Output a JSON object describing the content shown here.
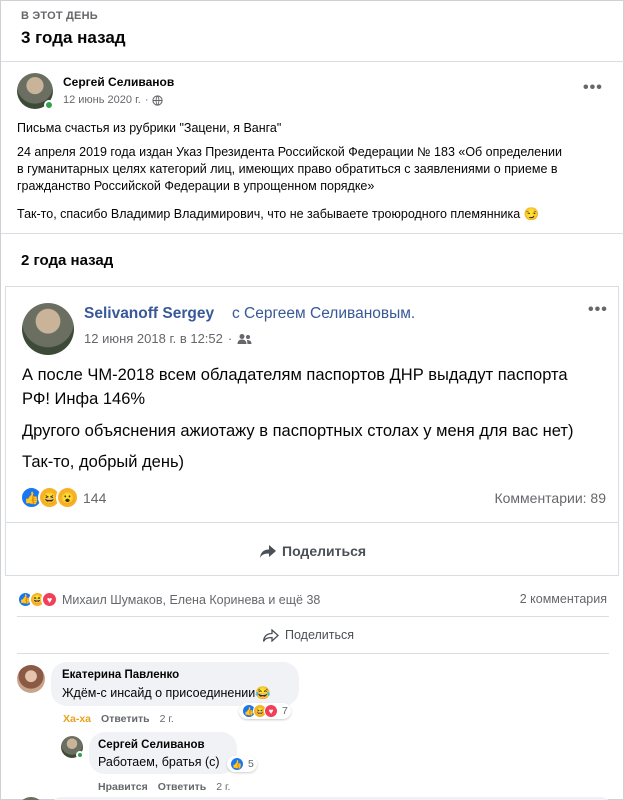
{
  "memory": {
    "label": "В ЭТОТ ДЕНЬ",
    "title": "3 года назад"
  },
  "post1": {
    "author": "Сергей Селиванов",
    "date": "12 июнь 2020 г.",
    "menu": "•••",
    "lines": [
      "Письма счастья из рубрики \"Зацени, я Ванга\"",
      "24 апреля 2019 года издан Указ Президента Российской Федерации № 183 «Об определении",
      "в гуманитарных целях категорий лиц, имеющих право обратиться с заявлениями о приеме в",
      "гражданство Российской Федерации в упрощенном порядке»",
      "Так-то, спасибо Владимир Владимирович, что не забываете  троюродного племянника 😏"
    ]
  },
  "memory2": {
    "title": "2 года назад"
  },
  "shared": {
    "author": "Selivanoff Sergey",
    "with": "с Сергеем Селивановым.",
    "date": "12 июня 2018 г. в 12:52",
    "menu": "•••",
    "lines": [
      "А после ЧМ-2018 всем обладателям паспортов ДНР выдадут паспорта",
      "РФ! Инфа 146%",
      "Другого объяснения ажиотажу в паспортных столах у меня для вас нет)",
      "Так-то, добрый день)"
    ],
    "reactions_count": "144",
    "comments": "Комментарии: 89",
    "share": "Поделиться"
  },
  "footer": {
    "reactors": "Михаил Шумаков, Елена Коринева и ещё 38",
    "comments": "2 комментария",
    "share": "Поделиться"
  },
  "comments": [
    {
      "author": "Екатерина Павленко",
      "text": "Ждём-с инсайд о присоединении😂",
      "haha": "Ха-ха",
      "reply": "Ответить",
      "time": "2 г.",
      "reactions": "7"
    },
    {
      "author": "Сергей Селиванов",
      "text": "Работаем, братья (с)",
      "like": "Нравится",
      "reply": "Ответить",
      "time": "2 г.",
      "reactions": "5"
    }
  ]
}
